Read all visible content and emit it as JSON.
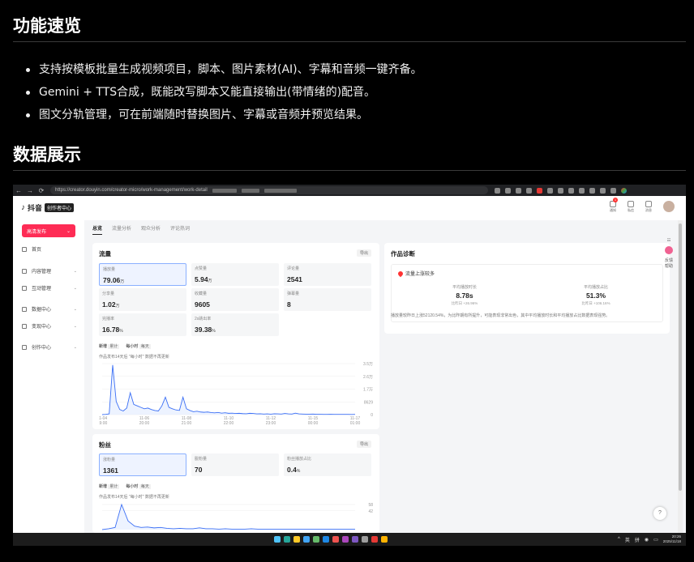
{
  "section1": {
    "title": "功能速览",
    "bullets": [
      "支持按模板批量生成视频项目，脚本、图片素材(AI)、字幕和音频一键齐备。",
      "Gemini + TTS合成，既能改写脚本又能直接输出(带情绪的)配音。",
      "图文分轨管理，可在前端随时替换图片、字幕或音频并预览结果。"
    ]
  },
  "section2": {
    "title": "数据展示"
  },
  "browser": {
    "url": "https://creator.douyin.com/creator-micro/work-management/work-detail",
    "nav_icons": [
      "back-icon",
      "forward-icon",
      "reload-icon"
    ]
  },
  "app": {
    "brand": "抖音",
    "brand_badge": "创作者中心",
    "top_icons": [
      {
        "label": "通知",
        "badge": "1"
      },
      {
        "label": "私信",
        "badge": ""
      },
      {
        "label": "消息",
        "badge": ""
      }
    ],
    "publish_label": "高清发布",
    "sidebar": [
      {
        "label": "首页",
        "chevron": false
      },
      {
        "label": "内容管理",
        "chevron": true
      },
      {
        "label": "互动管理",
        "chevron": true
      },
      {
        "label": "数据中心",
        "chevron": true
      },
      {
        "label": "变现中心",
        "chevron": true
      },
      {
        "label": "创作中心",
        "chevron": true
      }
    ],
    "tabs": [
      "总览",
      "流量分析",
      "观众分析",
      "评论热词"
    ],
    "traffic": {
      "title": "流量",
      "export": "导出",
      "metrics": [
        {
          "label": "播放量",
          "value": "79.06",
          "unit": "万"
        },
        {
          "label": "点赞量",
          "value": "5.94",
          "unit": "万"
        },
        {
          "label": "评论量",
          "value": "2541",
          "unit": ""
        },
        {
          "label": "分享量",
          "value": "1.02",
          "unit": "万"
        },
        {
          "label": "收藏量",
          "value": "9605",
          "unit": ""
        },
        {
          "label": "弹幕量",
          "value": "8",
          "unit": ""
        },
        {
          "label": "完播率",
          "value": "16.78",
          "unit": "%"
        },
        {
          "label": "2s跳出率",
          "value": "39.38",
          "unit": "%"
        }
      ],
      "toggles": [
        "新增",
        "累计",
        "每小时",
        "每天"
      ],
      "note": "作品发布14天后 \"每小时\" 数据不再更新"
    },
    "fans": {
      "title": "粉丝",
      "export": "导出",
      "metrics": [
        {
          "label": "涨粉量",
          "value": "1361",
          "unit": ""
        },
        {
          "label": "脱粉量",
          "value": "70",
          "unit": ""
        },
        {
          "label": "粉丝播放占比",
          "value": "0.4",
          "unit": "%"
        }
      ],
      "toggles": [
        "新增",
        "累计",
        "每小时",
        "每天"
      ],
      "note": "作品发布14天后 \"每小时\" 数据不再更新"
    },
    "diagnosis": {
      "title": "作品诊断",
      "headline": "流量上涨较多",
      "stats": [
        {
          "label": "平均播放时长",
          "value": "8.78s",
          "compare": "比昨日 +26.96%"
        },
        {
          "label": "平均播放占比",
          "value": "51.3%",
          "compare": "比昨日 +106.16%"
        }
      ],
      "desc": "播放量较昨日上涨52120.54%，为比昨期有所提升，可能表现非常出色，其中平均播放时长和平均播放占比数据表现强势。"
    },
    "right_rail": [
      "反馈",
      "帮助"
    ],
    "help": "?"
  },
  "taskbar": {
    "tray_labels": [
      "英",
      "拼"
    ],
    "time": "20:26",
    "date": "2025/11/18"
  },
  "chart_data": [
    {
      "type": "line",
      "name": "traffic",
      "x": [
        "11-04 19:00",
        "11-06 20:00",
        "11-08 21:00",
        "11-10 22:00",
        "11-12 23:00",
        "11-15 00:00",
        "11-17 01:00"
      ],
      "ytick_labels": [
        "3.5万",
        "2.6万",
        "1.7万",
        "8629",
        "0"
      ],
      "ylim": [
        0,
        35000
      ],
      "values": [
        0,
        200,
        500,
        34000,
        9000,
        3500,
        2500,
        4500,
        15000,
        7000,
        6000,
        5000,
        4000,
        4500,
        3500,
        2800,
        2500,
        6000,
        12000,
        5000,
        4000,
        3200,
        2900,
        12000,
        4000,
        2800,
        2000,
        2300,
        1800,
        1600,
        1800,
        1400,
        1200,
        1500,
        1000,
        1300,
        900,
        1000,
        800,
        900,
        700,
        600,
        900,
        800,
        500,
        600,
        400,
        500,
        300,
        600,
        500,
        400,
        800,
        500,
        400,
        1000,
        500,
        400,
        300,
        300,
        350,
        250,
        250,
        200,
        200,
        250,
        150,
        180,
        150,
        200,
        150,
        120,
        200
      ]
    },
    {
      "type": "line",
      "name": "fans",
      "ytick_labels": [
        "58",
        "42"
      ],
      "ylim": [
        0,
        58
      ],
      "values": [
        0,
        2,
        5,
        58,
        20,
        8,
        5,
        6,
        4,
        5,
        3,
        2,
        3,
        2,
        2,
        4,
        2,
        2,
        1,
        2,
        1,
        1,
        1,
        2,
        1,
        1,
        1,
        1,
        1,
        1,
        1,
        1,
        1,
        1,
        1,
        1,
        1,
        1,
        1,
        1
      ]
    }
  ]
}
